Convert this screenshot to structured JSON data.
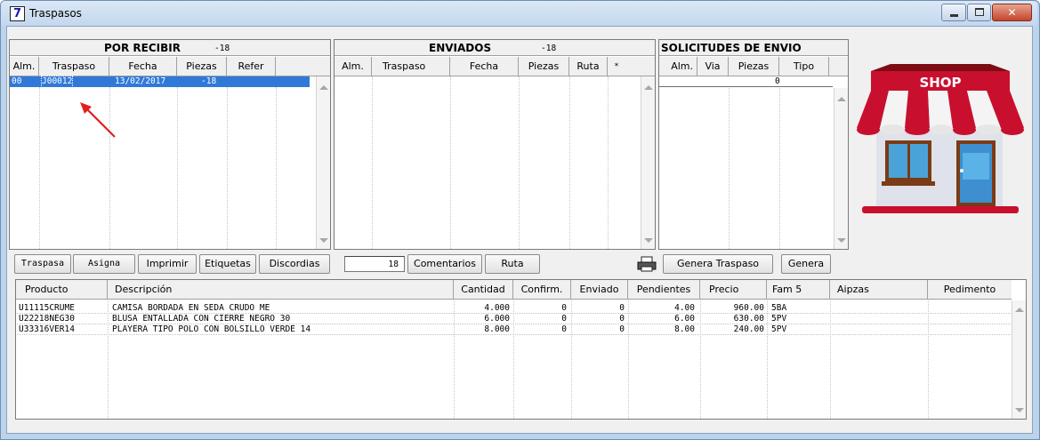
{
  "window": {
    "icon_glyph": "7",
    "title": "Traspasos",
    "close_glyph": "✕"
  },
  "por_recibir": {
    "title": "POR RECIBIR",
    "count": "-18",
    "headers": [
      "Alm.",
      "Traspaso",
      "Fecha",
      "Piezas",
      "Refer"
    ],
    "rows": [
      {
        "alm": "00",
        "traspaso": "J00012",
        "fecha": "13/02/2017",
        "piezas": "-18",
        "refer": ""
      }
    ]
  },
  "enviados": {
    "title": "ENVIADOS",
    "count": "-18",
    "headers": [
      "Alm.",
      "Traspaso",
      "Fecha",
      "Piezas",
      "Ruta",
      "*"
    ]
  },
  "solicitudes": {
    "title": "SOLICITUDES DE ENVIO",
    "headers": [
      "Alm.",
      "Via",
      "Piezas",
      "Tipo"
    ],
    "total": "0"
  },
  "shop_image": {
    "sign_text": "SHOP"
  },
  "toolbar": {
    "traspasa": "Traspasa",
    "asigna": "Asigna",
    "imprimir": "Imprimir",
    "etiquetas": "Etiquetas",
    "discordias": "Discordias",
    "count_value": "18",
    "comentarios": "Comentarios",
    "ruta": "Ruta",
    "genera_traspaso": "Genera Traspaso",
    "genera": "Genera"
  },
  "details": {
    "headers": [
      "Producto",
      "Descripción",
      "Cantidad",
      "Confirm.",
      "Enviado",
      "Pendientes",
      "Precio",
      "Fam 5",
      "Aipzas",
      "Pedimento"
    ],
    "rows": [
      {
        "producto": "U11115CRUME",
        "descripcion": "CAMISA BORDADA EN SEDA CRUDO ME",
        "cantidad": "4.000",
        "confirm": "0",
        "enviado": "0",
        "pendientes": "4.00",
        "precio": "960.00",
        "fam5": "5BA",
        "aipzas": "",
        "pedimento": ""
      },
      {
        "producto": "U22218NEG30",
        "descripcion": "BLUSA ENTALLADA CON CIERRE NEGRO 30",
        "cantidad": "6.000",
        "confirm": "0",
        "enviado": "0",
        "pendientes": "6.00",
        "precio": "630.00",
        "fam5": "5PV",
        "aipzas": "",
        "pedimento": ""
      },
      {
        "producto": "U33316VER14",
        "descripcion": "PLAYERA TIPO POLO CON BOLSILLO VERDE 14",
        "cantidad": "8.000",
        "confirm": "0",
        "enviado": "0",
        "pendientes": "8.00",
        "precio": "240.00",
        "fam5": "5PV",
        "aipzas": "",
        "pedimento": ""
      }
    ]
  },
  "colors": {
    "selection": "#3079d9",
    "annotation_arrow": "#e02020",
    "awning_red": "#c8102e",
    "window_frame": "#bcd3ea"
  }
}
